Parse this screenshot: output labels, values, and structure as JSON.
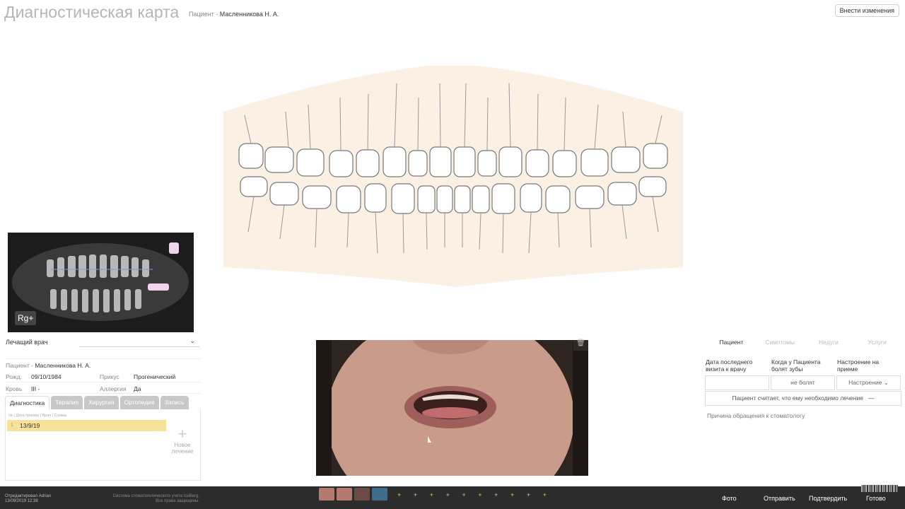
{
  "header": {
    "title": "Диагностическая карта",
    "patient_prefix": "Пациент - ",
    "patient_name": "Масленникова Н. А.",
    "edit_button": "Внести изменения"
  },
  "xray": {
    "label": "Rg+"
  },
  "doctor": {
    "label": "Лечащий врач",
    "value": ""
  },
  "patient_info": {
    "patient_prefix": "Пациент - ",
    "name": "Масленникова Н. А.",
    "birth_label": "Рожд.",
    "birth": "09/10/1984",
    "bite_label": "Прикус",
    "bite": "Прогенический",
    "blood_label": "Кровь",
    "blood": "III -",
    "allergy_label": "Аллергия",
    "allergy": "Да"
  },
  "tabs": [
    "Диагностика",
    "Терапия",
    "Хирургия",
    "Ортопедия",
    "Запись"
  ],
  "table": {
    "columns": "№ | Дата приема | Врач                         | Сумма",
    "row": {
      "num": "1",
      "date": "13/9/19"
    },
    "new_label": "Новое лечение"
  },
  "right_panel": {
    "tabs": [
      "Пациент",
      "Симптомы",
      "Недуги",
      "Услуги"
    ],
    "q1": "Дата последнего визита к врачу",
    "q2": "Когда у Пациента болят зубы",
    "q3": "Настроение на приеме",
    "a1": "",
    "a2": "не болят",
    "a3": "Настроение",
    "treatment_needed": "Пациент считает, что ему необходимо лечение",
    "treatment_dash": "—",
    "reason": "Причина обращения к стоматологу"
  },
  "footer": {
    "edited_by": "Отредактировал Adrian",
    "edited_at": "13/09/2019 12:38",
    "system": "Система стоматологического учета IceBerg.",
    "rights": "Все права защищены.",
    "buttons": [
      "Фото",
      "Отправить",
      "Подтвердить",
      "Готово"
    ]
  },
  "colors": {
    "highlight": "#f7e29a",
    "footer_bg": "#2c2c2c",
    "plus": "#d9c86b"
  }
}
